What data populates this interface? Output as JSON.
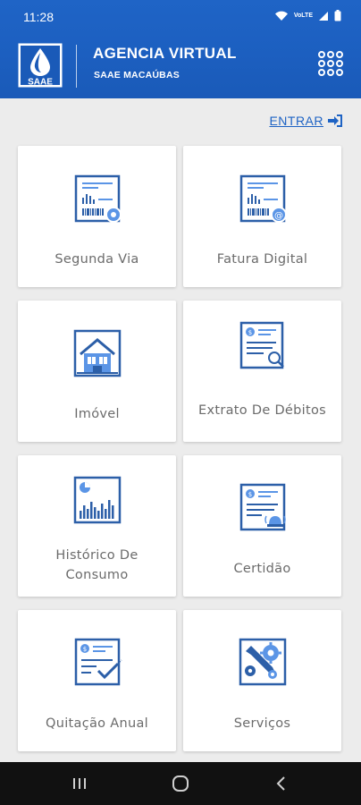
{
  "status": {
    "time": "11:28",
    "network_label": "VoLTE"
  },
  "header": {
    "title": "AGENCIA VIRTUAL",
    "subtitle": "SAAE MACAÚBAS",
    "logo_text": "SAAE"
  },
  "login": {
    "label": "ENTRAR"
  },
  "tiles": [
    {
      "label": "Segunda Via",
      "icon": "invoice-copy-icon"
    },
    {
      "label": "Fatura Digital",
      "icon": "digital-invoice-icon"
    },
    {
      "label": "Imóvel",
      "icon": "house-icon"
    },
    {
      "label": "Extrato De Débitos",
      "icon": "debt-statement-icon"
    },
    {
      "label": "Histórico De Consumo",
      "icon": "consumption-history-icon"
    },
    {
      "label": "Certidão",
      "icon": "certificate-icon"
    },
    {
      "label": "Quitação Anual",
      "icon": "annual-settlement-icon"
    },
    {
      "label": "Serviços",
      "icon": "services-icon"
    }
  ],
  "colors": {
    "primary": "#1e63c4",
    "icon_dark": "#2c5fa8",
    "icon_light": "#5b95e6"
  }
}
